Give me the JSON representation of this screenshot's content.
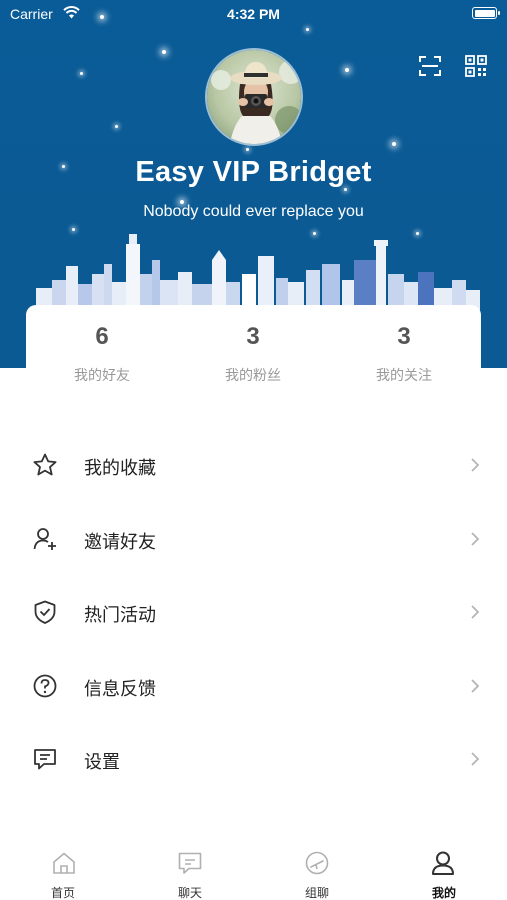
{
  "status_bar": {
    "carrier": "Carrier",
    "time": "4:32 PM"
  },
  "header": {
    "scan_icon": "scan-icon",
    "qr_icon": "qr-code-icon",
    "username": "Easy VIP Bridget",
    "bio": "Nobody could ever replace you",
    "background_color": "#0b5a94"
  },
  "stats": [
    {
      "value": "6",
      "label": "我的好友"
    },
    {
      "value": "3",
      "label": "我的粉丝"
    },
    {
      "value": "3",
      "label": "我的关注"
    }
  ],
  "menu": [
    {
      "label": "我的收藏",
      "icon": "star-icon"
    },
    {
      "label": "邀请好友",
      "icon": "add-user-icon"
    },
    {
      "label": "热门活动",
      "icon": "shield-check-icon"
    },
    {
      "label": "信息反馈",
      "icon": "question-icon"
    },
    {
      "label": "设置",
      "icon": "message-box-icon"
    }
  ],
  "tabbar": [
    {
      "label": "首页",
      "icon": "home-icon",
      "active": false
    },
    {
      "label": "聊天",
      "icon": "chat-icon",
      "active": false
    },
    {
      "label": "组聊",
      "icon": "group-chat-icon",
      "active": false
    },
    {
      "label": "我的",
      "icon": "profile-icon",
      "active": true
    }
  ]
}
